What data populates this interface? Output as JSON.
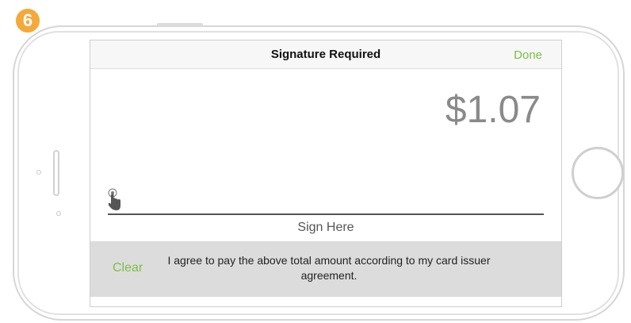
{
  "step_badge": "6",
  "nav": {
    "title": "Signature Required",
    "done_label": "Done"
  },
  "amount": "$1.07",
  "signature": {
    "label": "Sign Here"
  },
  "footer": {
    "clear_label": "Clear",
    "agreement_text": "I agree to pay the above total amount according to my card issuer agreement."
  },
  "colors": {
    "accent": "#7cc043",
    "badge": "#f4a93a",
    "amount": "#8a8a8a",
    "footer_bg": "#dcdcdc"
  },
  "icons": {
    "pen": "finger-pointer-icon",
    "home": "home-button-icon"
  }
}
